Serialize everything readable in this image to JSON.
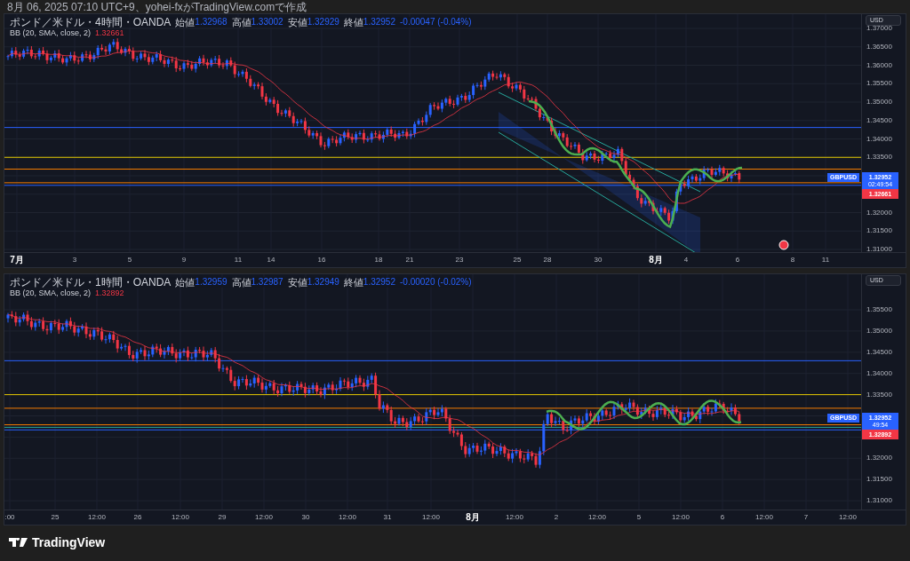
{
  "header": "8月 06, 2025 07:10 UTC+9、yohei-fxがTradingView.comで作成",
  "charts": [
    {
      "legend": {
        "symbol": "ポンド／米ドル・4時間・OANDA",
        "values": [
          {
            "label": "始値",
            "value": "1.32968"
          },
          {
            "label": "高値",
            "value": "1.33002"
          },
          {
            "label": "安値",
            "value": "1.32929"
          },
          {
            "label": "終値",
            "value": "1.32952"
          }
        ],
        "change": "-0.00047 (-0.04%)"
      },
      "indicator": {
        "label": "BB (20, SMA, close, 2)",
        "value": "1.32661"
      },
      "currency_button": "USD",
      "price_axis": [
        "1.37000",
        "1.36500",
        "1.36000",
        "1.35500",
        "1.35000",
        "1.34500",
        "1.34000",
        "1.33500",
        "1.32000",
        "1.31500",
        "1.31000"
      ],
      "tags": {
        "symbol": "GBPUSD",
        "price": "1.32952",
        "countdown": "02:49:54",
        "band": "1.32661"
      },
      "time_axis": [
        {
          "label": "7月",
          "major": true
        },
        {
          "label": "3",
          "major": false
        },
        {
          "label": "5",
          "major": false
        },
        {
          "label": "9",
          "major": false
        },
        {
          "label": "11",
          "major": false
        },
        {
          "label": "14",
          "major": false
        },
        {
          "label": "16",
          "major": false
        },
        {
          "label": "18",
          "major": false
        },
        {
          "label": "21",
          "major": false
        },
        {
          "label": "23",
          "major": false
        },
        {
          "label": "25",
          "major": false
        },
        {
          "label": "28",
          "major": false
        },
        {
          "label": "30",
          "major": false
        },
        {
          "label": "8月",
          "major": true
        },
        {
          "label": "4",
          "major": false
        },
        {
          "label": "6",
          "major": false
        },
        {
          "label": "8",
          "major": false
        },
        {
          "label": "11",
          "major": false
        }
      ]
    },
    {
      "legend": {
        "symbol": "ポンド／米ドル・1時間・OANDA",
        "values": [
          {
            "label": "始値",
            "value": "1.32959"
          },
          {
            "label": "高値",
            "value": "1.32987"
          },
          {
            "label": "安値",
            "value": "1.32949"
          },
          {
            "label": "終値",
            "value": "1.32952"
          }
        ],
        "change": "-0.00020 (-0.02%)"
      },
      "indicator": {
        "label": "BB (20, SMA, close, 2)",
        "value": "1.32892"
      },
      "currency_button": "USD",
      "price_axis": [
        "1.35500",
        "1.35000",
        "1.34500",
        "1.34000",
        "1.33500",
        "1.32000",
        "1.31500",
        "1.31000"
      ],
      "tags": {
        "symbol": "GBPUSD",
        "price": "1.32952",
        "countdown": "49:54",
        "band": "1.32892"
      },
      "time_axis": [
        {
          "label": ":00",
          "major": false
        },
        {
          "label": "25",
          "major": false
        },
        {
          "label": "12:00",
          "major": false
        },
        {
          "label": "26",
          "major": false
        },
        {
          "label": "12:00",
          "major": false
        },
        {
          "label": "29",
          "major": false
        },
        {
          "label": "12:00",
          "major": false
        },
        {
          "label": "30",
          "major": false
        },
        {
          "label": "12:00",
          "major": false
        },
        {
          "label": "31",
          "major": false
        },
        {
          "label": "12:00",
          "major": false
        },
        {
          "label": "8月",
          "major": true
        },
        {
          "label": "12:00",
          "major": false
        },
        {
          "label": "2",
          "major": false
        },
        {
          "label": "12:00",
          "major": false
        },
        {
          "label": "5",
          "major": false
        },
        {
          "label": "12:00",
          "major": false
        },
        {
          "label": "6",
          "major": false
        },
        {
          "label": "12:00",
          "major": false
        },
        {
          "label": "7",
          "major": false
        },
        {
          "label": "12:00",
          "major": false
        }
      ]
    }
  ],
  "footer": {
    "logo_text": "TradingView"
  }
}
